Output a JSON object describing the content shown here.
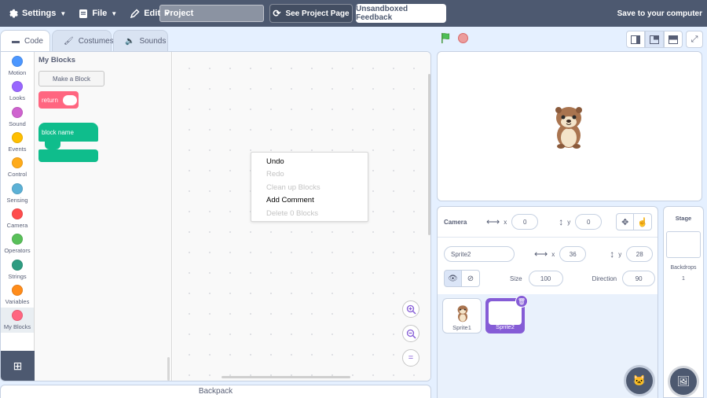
{
  "menu": {
    "settings": "Settings",
    "file": "File",
    "edit": "Edit",
    "project_title": "Project",
    "see_project_page": "See Project Page",
    "feedback": "Unsandboxed Feedback",
    "save": "Save to your computer"
  },
  "tabs": [
    "Code",
    "Costumes",
    "Sounds"
  ],
  "categories": [
    {
      "label": "Motion",
      "color": "#4c97ff"
    },
    {
      "label": "Looks",
      "color": "#9966ff"
    },
    {
      "label": "Sound",
      "color": "#cf63cf"
    },
    {
      "label": "Events",
      "color": "#ffbf00"
    },
    {
      "label": "Control",
      "color": "#ffab19"
    },
    {
      "label": "Sensing",
      "color": "#5cb1d6"
    },
    {
      "label": "Camera",
      "color": "#ff4c4c"
    },
    {
      "label": "Operators",
      "color": "#59c059"
    },
    {
      "label": "Strings",
      "color": "#2e9c81"
    },
    {
      "label": "Variables",
      "color": "#ff8c1a"
    },
    {
      "label": "My Blocks",
      "color": "#ff6680"
    }
  ],
  "flyout": {
    "title": "My Blocks",
    "make_block": "Make a Block",
    "return_block": "return",
    "define_block": "block name"
  },
  "context_menu": [
    {
      "label": "Undo",
      "enabled": true
    },
    {
      "label": "Redo",
      "enabled": false
    },
    {
      "label": "Clean up Blocks",
      "enabled": false
    },
    {
      "label": "Add Comment",
      "enabled": true
    },
    {
      "label": "Delete 0 Blocks",
      "enabled": false
    }
  ],
  "zoom": {
    "reset": "="
  },
  "backpack": "Backpack",
  "camera": {
    "label": "Camera",
    "x_label": "x",
    "x": "0",
    "y_label": "y",
    "y": "0"
  },
  "sprite": {
    "name": "Sprite2",
    "x_label": "x",
    "x": "36",
    "y_label": "y",
    "y": "28",
    "size_label": "Size",
    "size": "100",
    "direction_label": "Direction",
    "direction": "90"
  },
  "sprites": [
    {
      "name": "Sprite1",
      "selected": false
    },
    {
      "name": "Sprite2",
      "selected": true
    }
  ],
  "stage_pane": {
    "title": "Stage",
    "backdrops_label": "Backdrops",
    "backdrops_count": "1"
  }
}
